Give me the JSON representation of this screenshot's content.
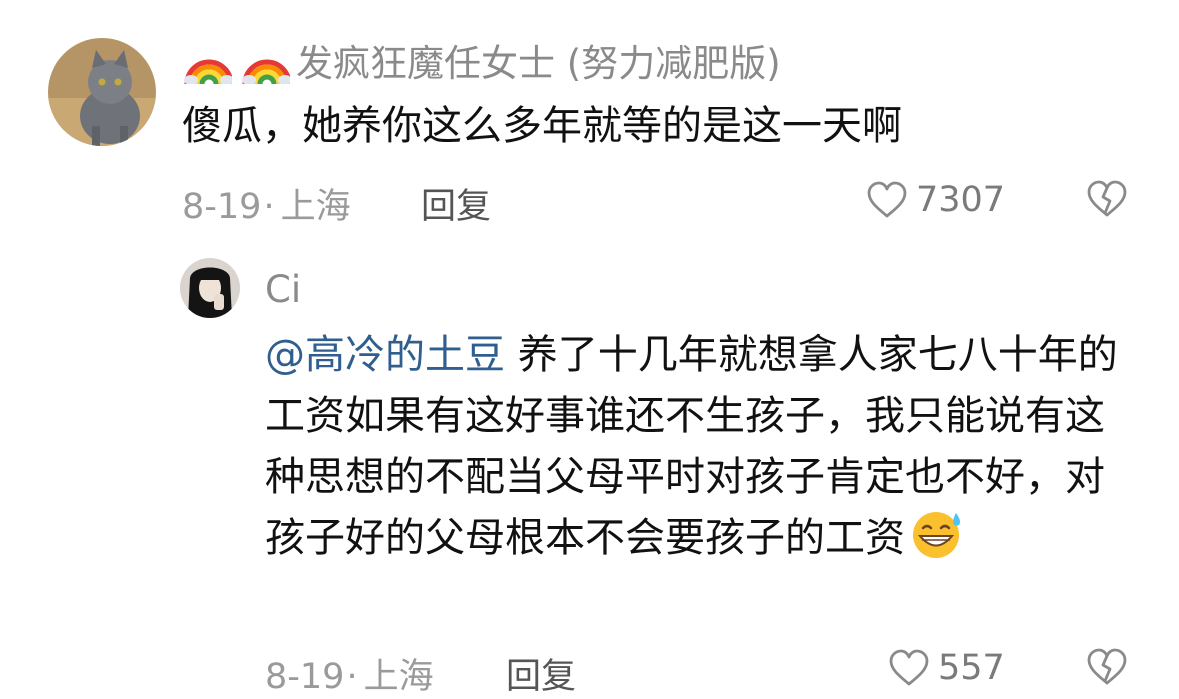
{
  "comment": {
    "nickname": "发疯狂魔任女士 (努力减肥版)",
    "text": "傻瓜，她养你这么多年就等的是这一天啊",
    "date": "8-19",
    "separator": "·",
    "location": "上海",
    "reply_label": "回复",
    "likes": "7307"
  },
  "reply": {
    "nickname": "Ci",
    "mention": "@高冷的土豆",
    "text": " 养了十几年就想拿人家七八十年的工资如果有这好事谁还不生孩子，我只能说有这种思想的不配当父母平时对孩子肯定也不好，对孩子好的父母根本不会要孩子的工资",
    "date": "8-19",
    "separator": "·",
    "location": "上海",
    "reply_label": "回复",
    "likes": "557"
  },
  "icons": {
    "like": "heart-outline-icon",
    "dislike": "broken-heart-icon",
    "emoji": "grinning-sweat-emoji-icon",
    "badge": "rainbow-icon"
  }
}
